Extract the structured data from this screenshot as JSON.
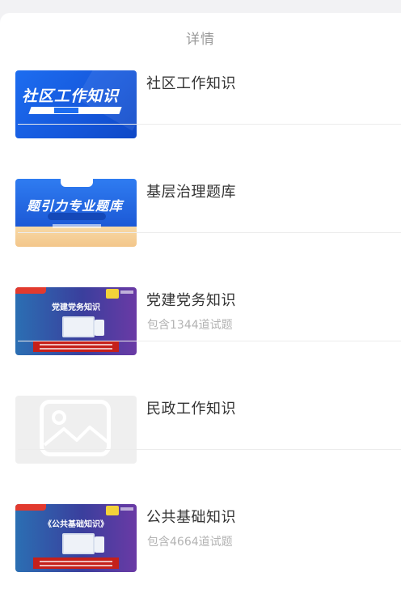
{
  "header": {
    "title": "详情"
  },
  "items": [
    {
      "title": "社区工作知识",
      "subtitle": "",
      "thumb": {
        "banner": "社区工作知识",
        "type": "blue-banner"
      }
    },
    {
      "title": "基层治理题库",
      "subtitle": "",
      "thumb": {
        "banner": "题引力专业题库",
        "type": "blue-gold-banner"
      }
    },
    {
      "title": "党建党务知识",
      "subtitle": "包含1344道试题",
      "thumb": {
        "banner": "党建党务知识",
        "type": "purple-banner"
      }
    },
    {
      "title": "民政工作知识",
      "subtitle": "",
      "thumb": {
        "banner": "",
        "type": "image-placeholder"
      }
    },
    {
      "title": "公共基础知识",
      "subtitle": "包含4664道试题",
      "thumb": {
        "banner": "《公共基础知识》",
        "type": "purple-banner"
      }
    }
  ],
  "colors": {
    "background": "#f2f2f4",
    "sheet": "#ffffff",
    "title": "#333333",
    "subtitle": "#b3b3b3",
    "header": "#9a9a9a"
  }
}
